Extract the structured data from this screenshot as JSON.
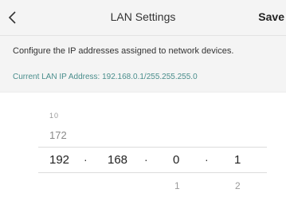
{
  "header": {
    "title": "LAN Settings",
    "save_label": "Save"
  },
  "description": "Configure the IP addresses assigned to network devices.",
  "current_ip": "Current LAN IP Address: 192.168.0.1/255.255.255.0",
  "picker": {
    "col1": {
      "far_above": "10",
      "above": "172",
      "selected": "192"
    },
    "col2": {
      "selected": "168"
    },
    "col3": {
      "selected": "0",
      "below": "1"
    },
    "col4": {
      "selected": "1",
      "below": "2"
    },
    "separator": "·"
  },
  "colors": {
    "accent_text": "#4a8e8c",
    "background": "#f4f4f4"
  },
  "icons": {
    "back": "chevron-left-icon"
  }
}
